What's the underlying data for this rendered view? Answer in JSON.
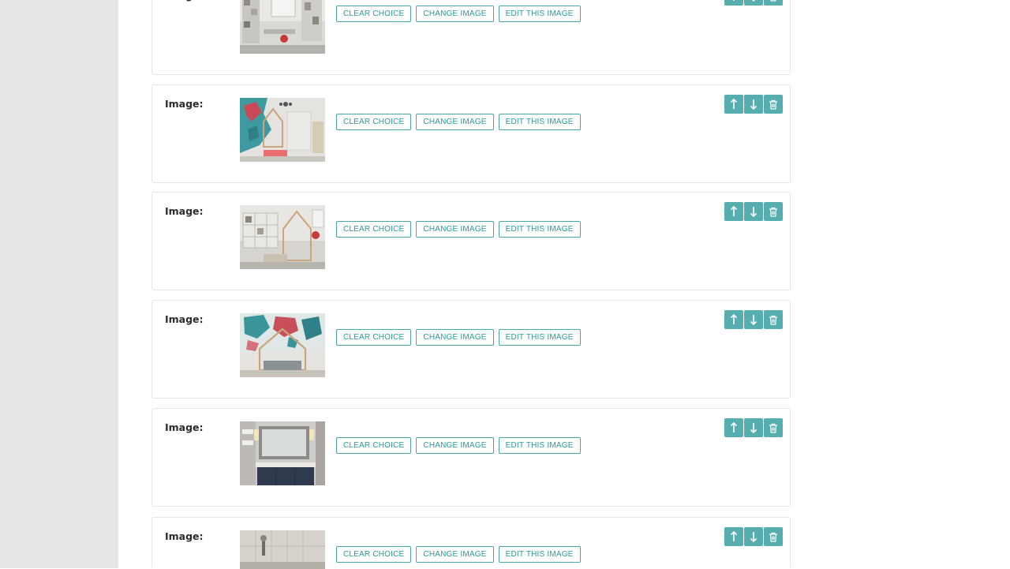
{
  "image_label": "Image:",
  "buttons": {
    "clear": "CLEAR CHOICE",
    "change": "CHANGE IMAGE",
    "edit": "EDIT THIS IMAGE"
  },
  "icons": {
    "up": "arrow-up-icon",
    "down": "arrow-down-icon",
    "delete": "trash-icon"
  },
  "colors": {
    "accent": "#56aeae",
    "accent_text": "#2c9a9a",
    "gutter": "#e5e5e5"
  },
  "blocks": [
    {
      "thumbnail": "kids-room-desk-shelves"
    },
    {
      "thumbnail": "kids-room-house-bed-map-wall"
    },
    {
      "thumbnail": "kids-room-shelves-house-bed"
    },
    {
      "thumbnail": "kids-room-map-mural-house-bed"
    },
    {
      "thumbnail": "bathroom-vanity-mirror"
    },
    {
      "thumbnail": "bathroom-shower"
    }
  ]
}
